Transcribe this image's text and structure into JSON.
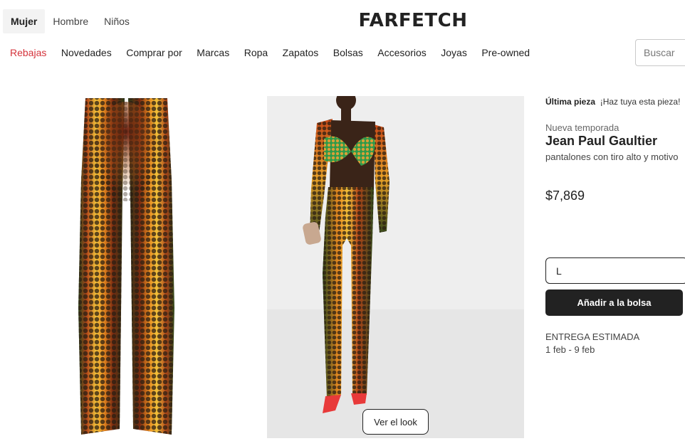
{
  "header": {
    "gender_tabs": [
      "Mujer",
      "Hombre",
      "Niños"
    ],
    "active_gender": "Mujer",
    "logo": "FARFETCH"
  },
  "nav": {
    "items": [
      "Rebajas",
      "Novedades",
      "Comprar por",
      "Marcas",
      "Ropa",
      "Zapatos",
      "Bolsas",
      "Accesorios",
      "Joyas",
      "Pre-owned"
    ],
    "sale_color": "#d4333b"
  },
  "search": {
    "placeholder": "Buscar"
  },
  "gallery": {
    "look_button": "Ver el look"
  },
  "product": {
    "badge_bold": "Última pieza",
    "badge_text": "¡Haz tuya esta pieza!",
    "season": "Nueva temporada",
    "brand": "Jean Paul Gaultier",
    "description": "pantalones con tiro alto y motivo",
    "price": "$7,869",
    "size": "L",
    "add_button": "Añadir a la bolsa",
    "delivery_label": "ENTREGA ESTIMADA",
    "delivery_dates": "1 feb - 9 feb"
  },
  "colors": {
    "accent": "#222222",
    "sale": "#d4333b",
    "image_bg": "#eeeeee"
  }
}
